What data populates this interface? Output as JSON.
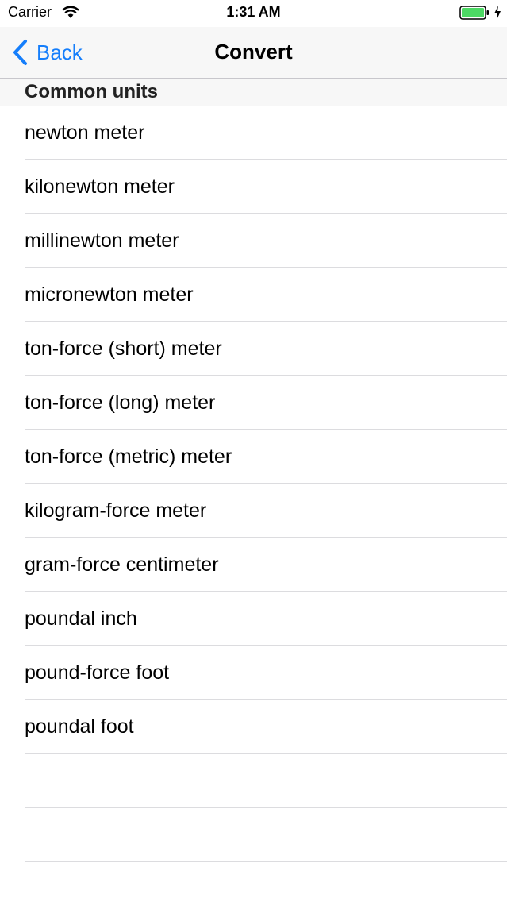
{
  "status_bar": {
    "carrier": "Carrier",
    "time": "1:31 AM",
    "battery_color": "#4cd964"
  },
  "nav": {
    "back_label": "Back",
    "title": "Convert",
    "accent_color": "#157efb"
  },
  "section": {
    "header": "Common units"
  },
  "units": [
    "newton meter",
    "kilonewton meter",
    "millinewton meter",
    "micronewton meter",
    "ton-force (short) meter",
    "ton-force (long) meter",
    "ton-force (metric) meter",
    "kilogram-force meter",
    "gram-force centimeter",
    "poundal inch",
    "pound-force foot",
    "poundal foot",
    "",
    ""
  ]
}
